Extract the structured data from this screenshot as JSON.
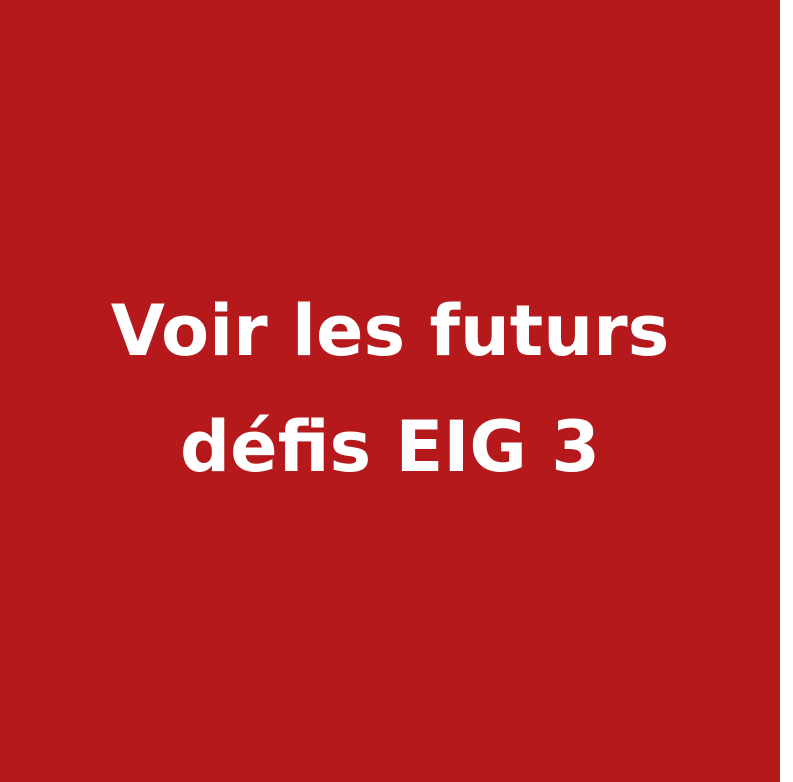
{
  "tile": {
    "line1": "Voir les futurs",
    "line2": "défis EIG 3",
    "background_color": "#b5191b",
    "text_color": "#ffffff"
  }
}
